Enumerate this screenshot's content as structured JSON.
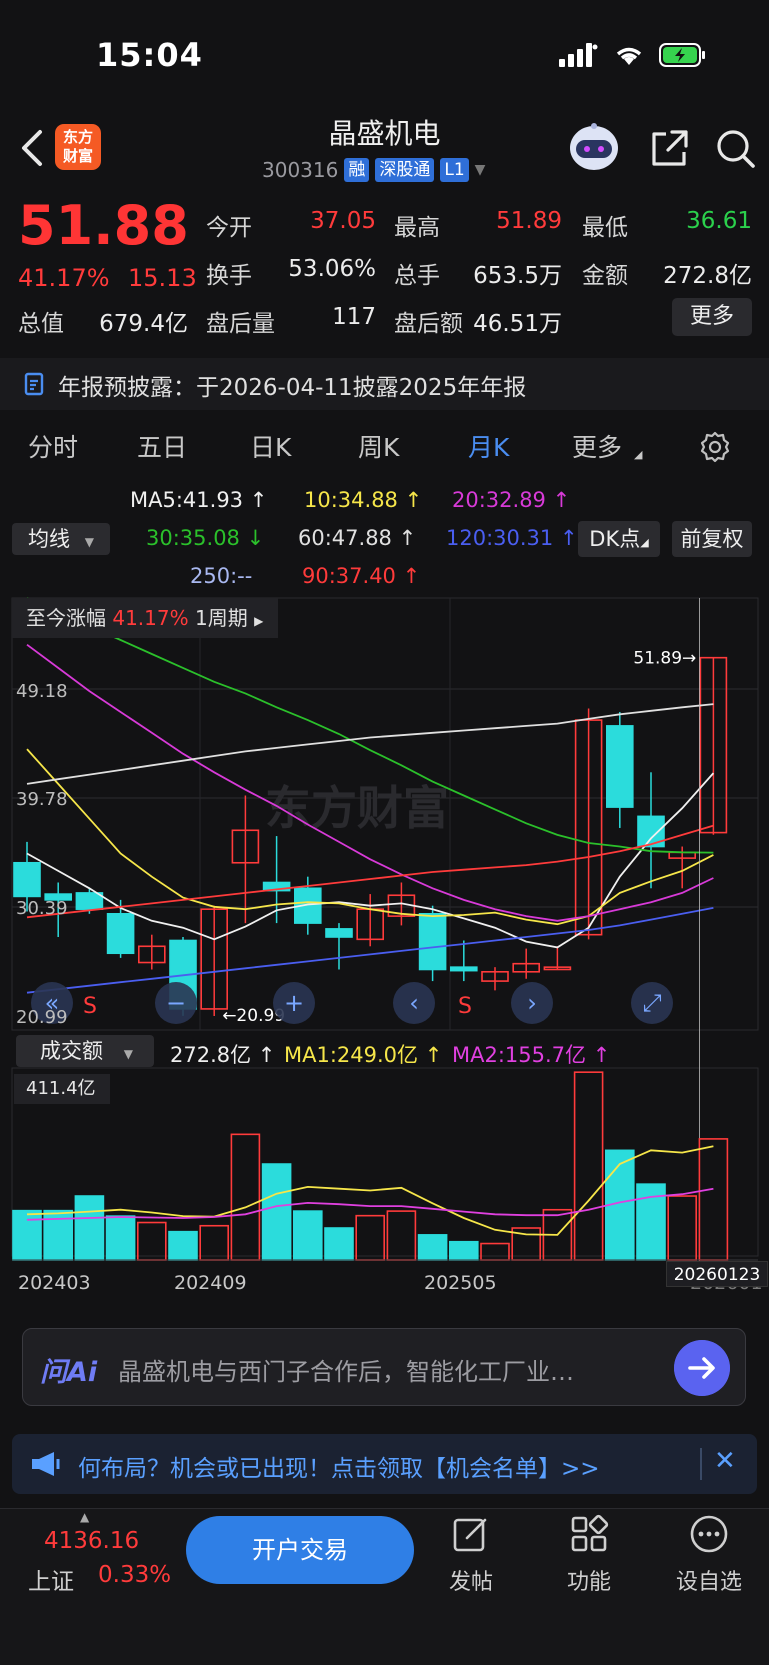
{
  "status_bar": {
    "time": "15:04"
  },
  "header": {
    "logo_text": "东方财富",
    "stock_name": "晶盛机电",
    "stock_code": "300316",
    "tags": [
      "融",
      "深股通",
      "L1"
    ]
  },
  "quote": {
    "price": "51.88",
    "change_pct": "41.17%",
    "change": "15.13",
    "rows": [
      [
        {
          "label": "今开",
          "value": "37.05",
          "color": "red"
        },
        {
          "label": "最高",
          "value": "51.89",
          "color": "red"
        },
        {
          "label": "最低",
          "value": "36.61",
          "color": "green"
        }
      ],
      [
        {
          "label": "换手",
          "value": "53.06%",
          "color": "white"
        },
        {
          "label": "总手",
          "value": "653.5万",
          "color": "white"
        },
        {
          "label": "金额",
          "value": "272.8亿",
          "color": "white"
        }
      ]
    ],
    "market_cap_label": "总值",
    "market_cap": "679.4亿",
    "after_vol_label": "盘后量",
    "after_vol": "117",
    "after_amt_label": "盘后额",
    "after_amt": "46.51万",
    "more_label": "更多"
  },
  "notice": "年报预披露：于2026-04-11披露2025年年报",
  "tabs": [
    "分时",
    "五日",
    "日K",
    "周K",
    "月K",
    "更多"
  ],
  "active_tab": "月K",
  "ma_legend": {
    "button": "均线",
    "items": [
      {
        "text": "MA5:41.93 ↑",
        "color": "#f0f0f0"
      },
      {
        "text": "10:34.88 ↑",
        "color": "#f6e64a"
      },
      {
        "text": "20:32.89 ↑",
        "color": "#d83ad8"
      },
      {
        "text": "30:35.08 ↓",
        "color": "#2bc02b"
      },
      {
        "text": "60:47.88 ↑",
        "color": "#e0e0e0"
      },
      {
        "text": "120:30.31 ↑",
        "color": "#4a5ef0"
      },
      {
        "text": "250:--",
        "color": "#a9b8f0"
      },
      {
        "text": "90:37.40 ↑",
        "color": "#ff3b3b"
      }
    ],
    "dk_button": "DK点",
    "adjust_button": "前复权"
  },
  "chart_data": {
    "type": "candlestick",
    "period_label": "至今涨幅",
    "period_pct": "41.17%",
    "period_unit": "1周期",
    "y_ticks": [
      "49.18",
      "39.78",
      "30.39",
      "20.99"
    ],
    "ylim": [
      20.99,
      49.18
    ],
    "high_marker": "51.89",
    "low_marker": "20.99",
    "x_labels": [
      "202403",
      "202409",
      "202505",
      "202601"
    ],
    "last_date": "20260123",
    "candles": [
      {
        "o": 34.2,
        "c": 31.3,
        "h": 36.0,
        "l": 30.0
      },
      {
        "o": 31.5,
        "c": 31.0,
        "h": 32.5,
        "l": 27.8
      },
      {
        "o": 31.6,
        "c": 30.2,
        "h": 32.0,
        "l": 29.8
      },
      {
        "o": 29.8,
        "c": 26.4,
        "h": 31.0,
        "l": 26.0
      },
      {
        "o": 25.6,
        "c": 27.0,
        "h": 28.0,
        "l": 25.0
      },
      {
        "o": 27.5,
        "c": 21.6,
        "h": 27.8,
        "l": 21.0
      },
      {
        "o": 21.6,
        "c": 30.2,
        "h": 30.5,
        "l": 20.99
      },
      {
        "o": 34.2,
        "c": 37.0,
        "h": 40.0,
        "l": 29.0
      },
      {
        "o": 32.5,
        "c": 31.8,
        "h": 36.5,
        "l": 29.0
      },
      {
        "o": 32.0,
        "c": 29.0,
        "h": 33.0,
        "l": 28.0
      },
      {
        "o": 28.5,
        "c": 27.8,
        "h": 29.0,
        "l": 25.0
      },
      {
        "o": 27.6,
        "c": 30.2,
        "h": 31.5,
        "l": 27.0
      },
      {
        "o": 29.6,
        "c": 31.4,
        "h": 32.5,
        "l": 28.8
      },
      {
        "o": 29.8,
        "c": 25.0,
        "h": 30.5,
        "l": 24.0
      },
      {
        "o": 25.2,
        "c": 24.9,
        "h": 27.5,
        "l": 24.0
      },
      {
        "o": 24.0,
        "c": 24.8,
        "h": 25.2,
        "l": 23.2
      },
      {
        "o": 24.8,
        "c": 25.5,
        "h": 26.8,
        "l": 24.2
      },
      {
        "o": 25.0,
        "c": 25.2,
        "h": 27.0,
        "l": 25.0
      },
      {
        "o": 28.0,
        "c": 46.5,
        "h": 47.5,
        "l": 27.6
      },
      {
        "o": 46.0,
        "c": 39.0,
        "h": 47.2,
        "l": 37.2
      },
      {
        "o": 38.2,
        "c": 35.6,
        "h": 42.0,
        "l": 32.0
      },
      {
        "o": 34.6,
        "c": 35.1,
        "h": 35.6,
        "l": 32.0
      },
      {
        "o": 36.8,
        "c": 51.88,
        "h": 51.89,
        "l": 36.61
      }
    ],
    "ma_lines": [
      {
        "name": "MA5",
        "color": "#f0f0f0",
        "values": [
          35.0,
          33.5,
          32.0,
          30.3,
          29.2,
          28.6,
          27.6,
          28.7,
          30.1,
          30.6,
          30.8,
          30.5,
          30.7,
          30.2,
          29.4,
          28.6,
          27.4,
          26.9,
          28.6,
          33.0,
          36.3,
          38.9,
          41.93
        ]
      },
      {
        "name": "MA10",
        "color": "#f6e64a",
        "values": [
          44.0,
          41.0,
          38.0,
          35.0,
          33.0,
          31.2,
          30.4,
          30.2,
          30.6,
          30.8,
          30.7,
          30.2,
          29.8,
          29.6,
          29.7,
          29.9,
          29.3,
          28.9,
          29.6,
          31.6,
          32.6,
          33.5,
          34.88
        ]
      },
      {
        "name": "MA20",
        "color": "#d83ad8",
        "values": [
          53.0,
          51.0,
          49.0,
          47.2,
          45.4,
          43.6,
          42.0,
          40.5,
          39.1,
          37.5,
          36.0,
          34.5,
          33.2,
          32.0,
          31.0,
          30.2,
          29.6,
          29.2,
          29.6,
          30.2,
          30.8,
          31.6,
          32.89
        ]
      },
      {
        "name": "MA30",
        "color": "#2bc02b",
        "values": [
          57.0,
          55.8,
          54.6,
          53.4,
          52.2,
          51.0,
          49.8,
          48.8,
          47.6,
          46.5,
          45.3,
          43.9,
          42.6,
          41.2,
          40.0,
          38.8,
          37.6,
          36.6,
          35.9,
          35.6,
          35.2,
          35.1,
          35.08
        ]
      },
      {
        "name": "MA60",
        "color": "#e0e0e0",
        "values": [
          41.0,
          41.4,
          41.8,
          42.2,
          42.6,
          43.0,
          43.4,
          43.8,
          44.1,
          44.4,
          44.7,
          45.0,
          45.2,
          45.4,
          45.6,
          45.8,
          46.0,
          46.2,
          46.6,
          47.0,
          47.3,
          47.6,
          47.88
        ]
      },
      {
        "name": "MA90",
        "color": "#ff3b3b",
        "values": [
          29.5,
          29.8,
          30.1,
          30.4,
          30.7,
          31.0,
          31.3,
          31.6,
          31.9,
          32.2,
          32.5,
          32.8,
          33.1,
          33.4,
          33.6,
          33.8,
          34.0,
          34.3,
          34.7,
          35.2,
          35.8,
          36.6,
          37.4
        ]
      },
      {
        "name": "MA120",
        "color": "#4a5ef0",
        "values": [
          23.0,
          23.3,
          23.6,
          23.9,
          24.2,
          24.5,
          24.8,
          25.1,
          25.4,
          25.7,
          26.0,
          26.3,
          26.6,
          26.9,
          27.2,
          27.5,
          27.8,
          28.1,
          28.4,
          28.8,
          29.3,
          29.8,
          30.31
        ]
      }
    ],
    "volume": {
      "label": "成交额",
      "current": "272.8亿 ↑",
      "ma1": "MA1:249.0亿 ↑",
      "ma2": "MA2:155.7亿 ↑",
      "max_label": "411.4亿",
      "max": 411.4,
      "bars": [
        108,
        108,
        140,
        96,
        82,
        62,
        75,
        275,
        210,
        107,
        70,
        97,
        107,
        55,
        40,
        36,
        70,
        110,
        411,
        240,
        166,
        140,
        265
      ],
      "ma1_line": [
        100,
        102,
        106,
        110,
        104,
        96,
        95,
        115,
        145,
        160,
        156,
        152,
        158,
        124,
        92,
        66,
        56,
        55,
        130,
        210,
        240,
        235,
        249.0
      ],
      "ma2_line": [
        88,
        90,
        92,
        94,
        93,
        92,
        94,
        100,
        118,
        125,
        122,
        118,
        118,
        112,
        106,
        100,
        98,
        98,
        110,
        126,
        138,
        144,
        155.7
      ]
    }
  },
  "chart_controls": {
    "marker_s": "S"
  },
  "ask_ai": {
    "logo": "问Ai",
    "text": "晶盛机电与西门子合作后，智能化工厂业…"
  },
  "banner": {
    "text": "何布局？机会或已出现！点击领取【机会名单】>>",
    "close": "✕"
  },
  "bottom_nav": {
    "index_value": "4136.16",
    "index_name": "上证",
    "index_pct": "0.33%",
    "trade_button": "开户交易",
    "items": [
      "发帖",
      "功能",
      "设自选"
    ]
  }
}
